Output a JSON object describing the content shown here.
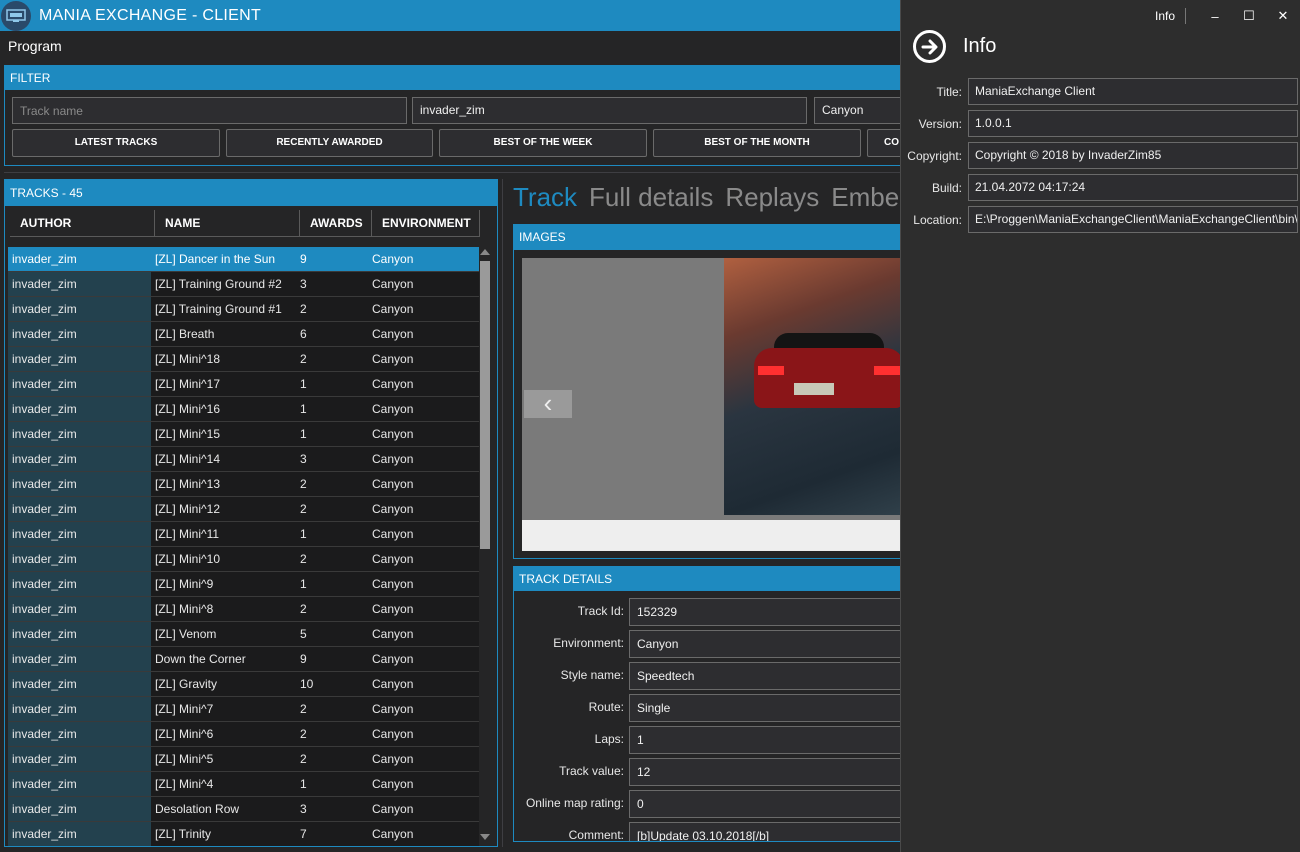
{
  "app": {
    "title": "MANIA EXCHANGE - CLIENT",
    "menu": "Program"
  },
  "colors": {
    "accent": "#1e8ac0",
    "background": "#252526",
    "selected_row": "#1e8ac0"
  },
  "filter": {
    "title": "FILTER",
    "track_name_placeholder": "Track name",
    "author_value": "invader_zim",
    "environment_value": "Canyon",
    "buttons": [
      "LATEST TRACKS",
      "RECENTLY AWARDED",
      "BEST OF THE WEEK",
      "BEST OF THE MONTH",
      "CO"
    ]
  },
  "tracks": {
    "title": "TRACKS - 45",
    "columns": [
      "AUTHOR",
      "NAME",
      "AWARDS",
      "ENVIRONMENT"
    ],
    "rows": [
      [
        "invader_zim",
        "[ZL] Dancer in the Sun",
        "9",
        "Canyon"
      ],
      [
        "invader_zim",
        "[ZL] Training Ground #2",
        "3",
        "Canyon"
      ],
      [
        "invader_zim",
        "[ZL] Training Ground #1",
        "2",
        "Canyon"
      ],
      [
        "invader_zim",
        "[ZL] Breath",
        "6",
        "Canyon"
      ],
      [
        "invader_zim",
        "[ZL] Mini^18",
        "2",
        "Canyon"
      ],
      [
        "invader_zim",
        "[ZL] Mini^17",
        "1",
        "Canyon"
      ],
      [
        "invader_zim",
        "[ZL] Mini^16",
        "1",
        "Canyon"
      ],
      [
        "invader_zim",
        "[ZL] Mini^15",
        "1",
        "Canyon"
      ],
      [
        "invader_zim",
        "[ZL] Mini^14",
        "3",
        "Canyon"
      ],
      [
        "invader_zim",
        "[ZL] Mini^13",
        "2",
        "Canyon"
      ],
      [
        "invader_zim",
        "[ZL] Mini^12",
        "2",
        "Canyon"
      ],
      [
        "invader_zim",
        "[ZL] Mini^11",
        "1",
        "Canyon"
      ],
      [
        "invader_zim",
        "[ZL] Mini^10",
        "2",
        "Canyon"
      ],
      [
        "invader_zim",
        "[ZL] Mini^9",
        "1",
        "Canyon"
      ],
      [
        "invader_zim",
        "[ZL] Mini^8",
        "2",
        "Canyon"
      ],
      [
        "invader_zim",
        "[ZL] Venom",
        "5",
        "Canyon"
      ],
      [
        "invader_zim",
        "Down the Corner",
        "9",
        "Canyon"
      ],
      [
        "invader_zim",
        "[ZL] Gravity",
        "10",
        "Canyon"
      ],
      [
        "invader_zim",
        "[ZL] Mini^7",
        "2",
        "Canyon"
      ],
      [
        "invader_zim",
        "[ZL] Mini^6",
        "2",
        "Canyon"
      ],
      [
        "invader_zim",
        "[ZL] Mini^5",
        "2",
        "Canyon"
      ],
      [
        "invader_zim",
        "[ZL] Mini^4",
        "1",
        "Canyon"
      ],
      [
        "invader_zim",
        "Desolation Row",
        "3",
        "Canyon"
      ],
      [
        "invader_zim",
        "[ZL] Trinity",
        "7",
        "Canyon"
      ]
    ]
  },
  "detail_tabs": [
    "Track",
    "Full details",
    "Replays",
    "Embed"
  ],
  "images": {
    "title": "IMAGES",
    "prev_glyph": "‹"
  },
  "track_details": {
    "title": "TRACK DETAILS",
    "fields": [
      {
        "label": "Track Id:",
        "value": "152329"
      },
      {
        "label": "Environment:",
        "value": "Canyon"
      },
      {
        "label": "Style name:",
        "value": "Speedtech"
      },
      {
        "label": "Route:",
        "value": "Single"
      },
      {
        "label": "Laps:",
        "value": "1"
      },
      {
        "label": "Track value:",
        "value": "12"
      },
      {
        "label": "Online map rating:",
        "value": "0"
      },
      {
        "label": "Comment:",
        "value": "[b]Update 03.10.2018[/b]"
      }
    ]
  },
  "info_window": {
    "caption": "Info",
    "title": "Info",
    "controls": {
      "minimize": "–",
      "maximize": "☐",
      "close": "✕"
    },
    "fields": [
      {
        "label": "Title:",
        "value": "ManiaExchange Client"
      },
      {
        "label": "Version:",
        "value": "1.0.0.1"
      },
      {
        "label": "Copyright:",
        "value": "Copyright ©  2018 by InvaderZim85"
      },
      {
        "label": "Build:",
        "value": "21.04.2072 04:17:24"
      },
      {
        "label": "Location:",
        "value": "E:\\Proggen\\ManiaExchangeClient\\ManiaExchangeClient\\bin\\"
      }
    ]
  }
}
